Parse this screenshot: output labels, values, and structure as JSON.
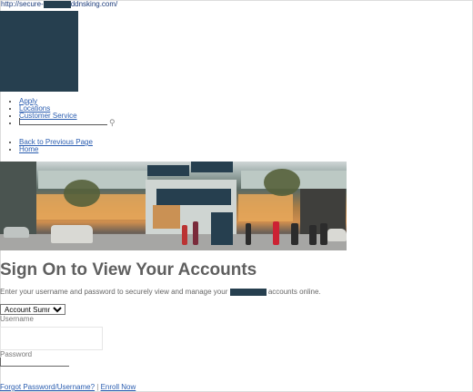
{
  "address_bar": {
    "prefix": "http://secure-",
    "suffix": "ddnsking.com/"
  },
  "nav_links": {
    "apply": "Apply",
    "locations": "Locations",
    "customer_service": "Customer Service"
  },
  "secondary_links": {
    "back": "Back to Previous Page",
    "home": "Home"
  },
  "page_title": "Sign On to View Your Accounts",
  "intro": {
    "before": "Enter your username and password to securely view and manage your",
    "after": "accounts online."
  },
  "account_select": {
    "selected": "Account Summary"
  },
  "username_label": "Username",
  "password_label": "Password",
  "footer": {
    "forgot": "Forgot Password/Username?",
    "separator": " | ",
    "enroll": "Enroll Now"
  },
  "colors": {
    "redaction": "#263f4f",
    "link": "#2a5db0",
    "title": "#5f5f5f"
  },
  "icons": {
    "search": "search-icon"
  }
}
